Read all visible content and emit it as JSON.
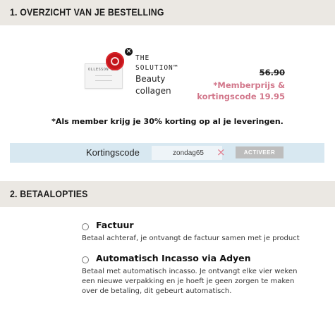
{
  "section1": {
    "title": "1. OVERZICHT VAN JE BESTELLING"
  },
  "product": {
    "image_brand": "OLLESSON LAB",
    "brand_line1": "THE",
    "brand_line2": "SOLUTION™",
    "name_line1": "Beauty",
    "name_line2": "collagen",
    "price_old": "56.90",
    "member_label_line1": "*Memberprijs &",
    "member_label_line2": "kortingscode 19.95",
    "remove_icon": "×"
  },
  "member_note": "*Als member krijg je 30% korting op al je leveringen.",
  "coupon": {
    "label": "Kortingscode",
    "value": "zondag65",
    "clear_icon": "×",
    "button_label": "ACTIVEER"
  },
  "section2": {
    "title": "2. BETAALOPTIES"
  },
  "payment_options": [
    {
      "name": "Factuur",
      "description": "Betaal achteraf, je ontvangt de factuur samen met je product"
    },
    {
      "name": "Automatisch Incasso via Adyen",
      "description": "Betaal met automatisch incasso. Je ontvangt elke vier weken een nieuwe verpakking en je hoeft je geen zorgen te maken over de betaling, dit gebeurt automatisch."
    }
  ],
  "colors": {
    "header_bg": "#ebe8e3",
    "coupon_bg": "#d8e8f1",
    "member_price": "#d2778b",
    "button_disabled": "#bdbdbd",
    "badge_red": "#c4161c"
  }
}
